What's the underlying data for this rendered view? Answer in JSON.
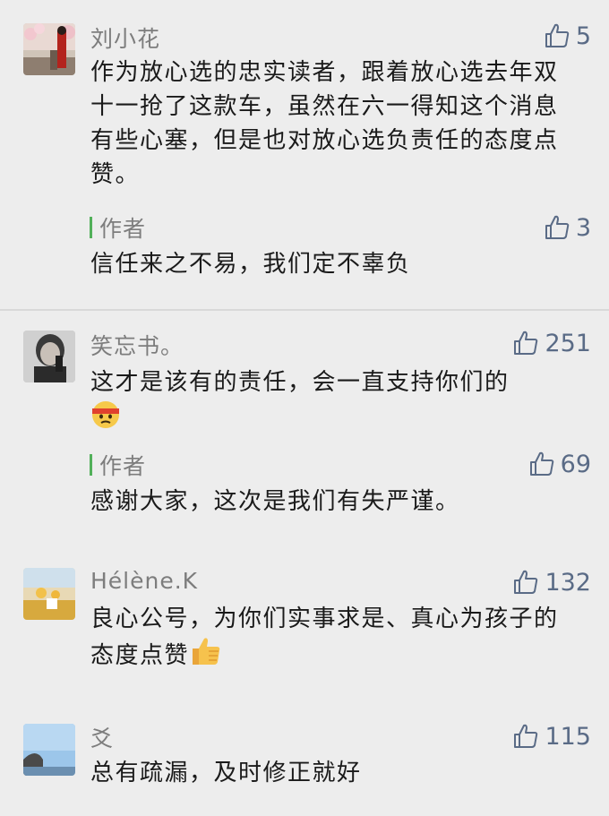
{
  "comments": [
    {
      "nickname": "刘小花",
      "likes": "5",
      "text": "作为放心选的忠实读者，跟着放心选去年双十一抢了这款车，虽然在六一得知这个消息有些心塞，但是也对放心选负责任的态度点赞。",
      "reply": {
        "author_label": "作者",
        "likes": "3",
        "text": "信任来之不易，我们定不辜负"
      }
    },
    {
      "nickname": "笑忘书。",
      "likes": "251",
      "text": "这才是该有的责任，会一直支持你们的",
      "emoji": "ninja-face-emoji",
      "reply": {
        "author_label": "作者",
        "likes": "69",
        "text": "感谢大家，这次是我们有失严谨。"
      }
    },
    {
      "nickname": "Hélène.K",
      "likes": "132",
      "text": "良心公号，为你们实事求是、真心为孩子的态度点赞",
      "emoji": "thumbs-up-emoji"
    },
    {
      "nickname": "爻",
      "likes": "115",
      "text": "总有疏漏，及时修正就好"
    }
  ],
  "colors": {
    "background": "#ededed",
    "nickname": "#7d7d7d",
    "like": "#5a6b86",
    "author_bar": "#52b05a"
  }
}
